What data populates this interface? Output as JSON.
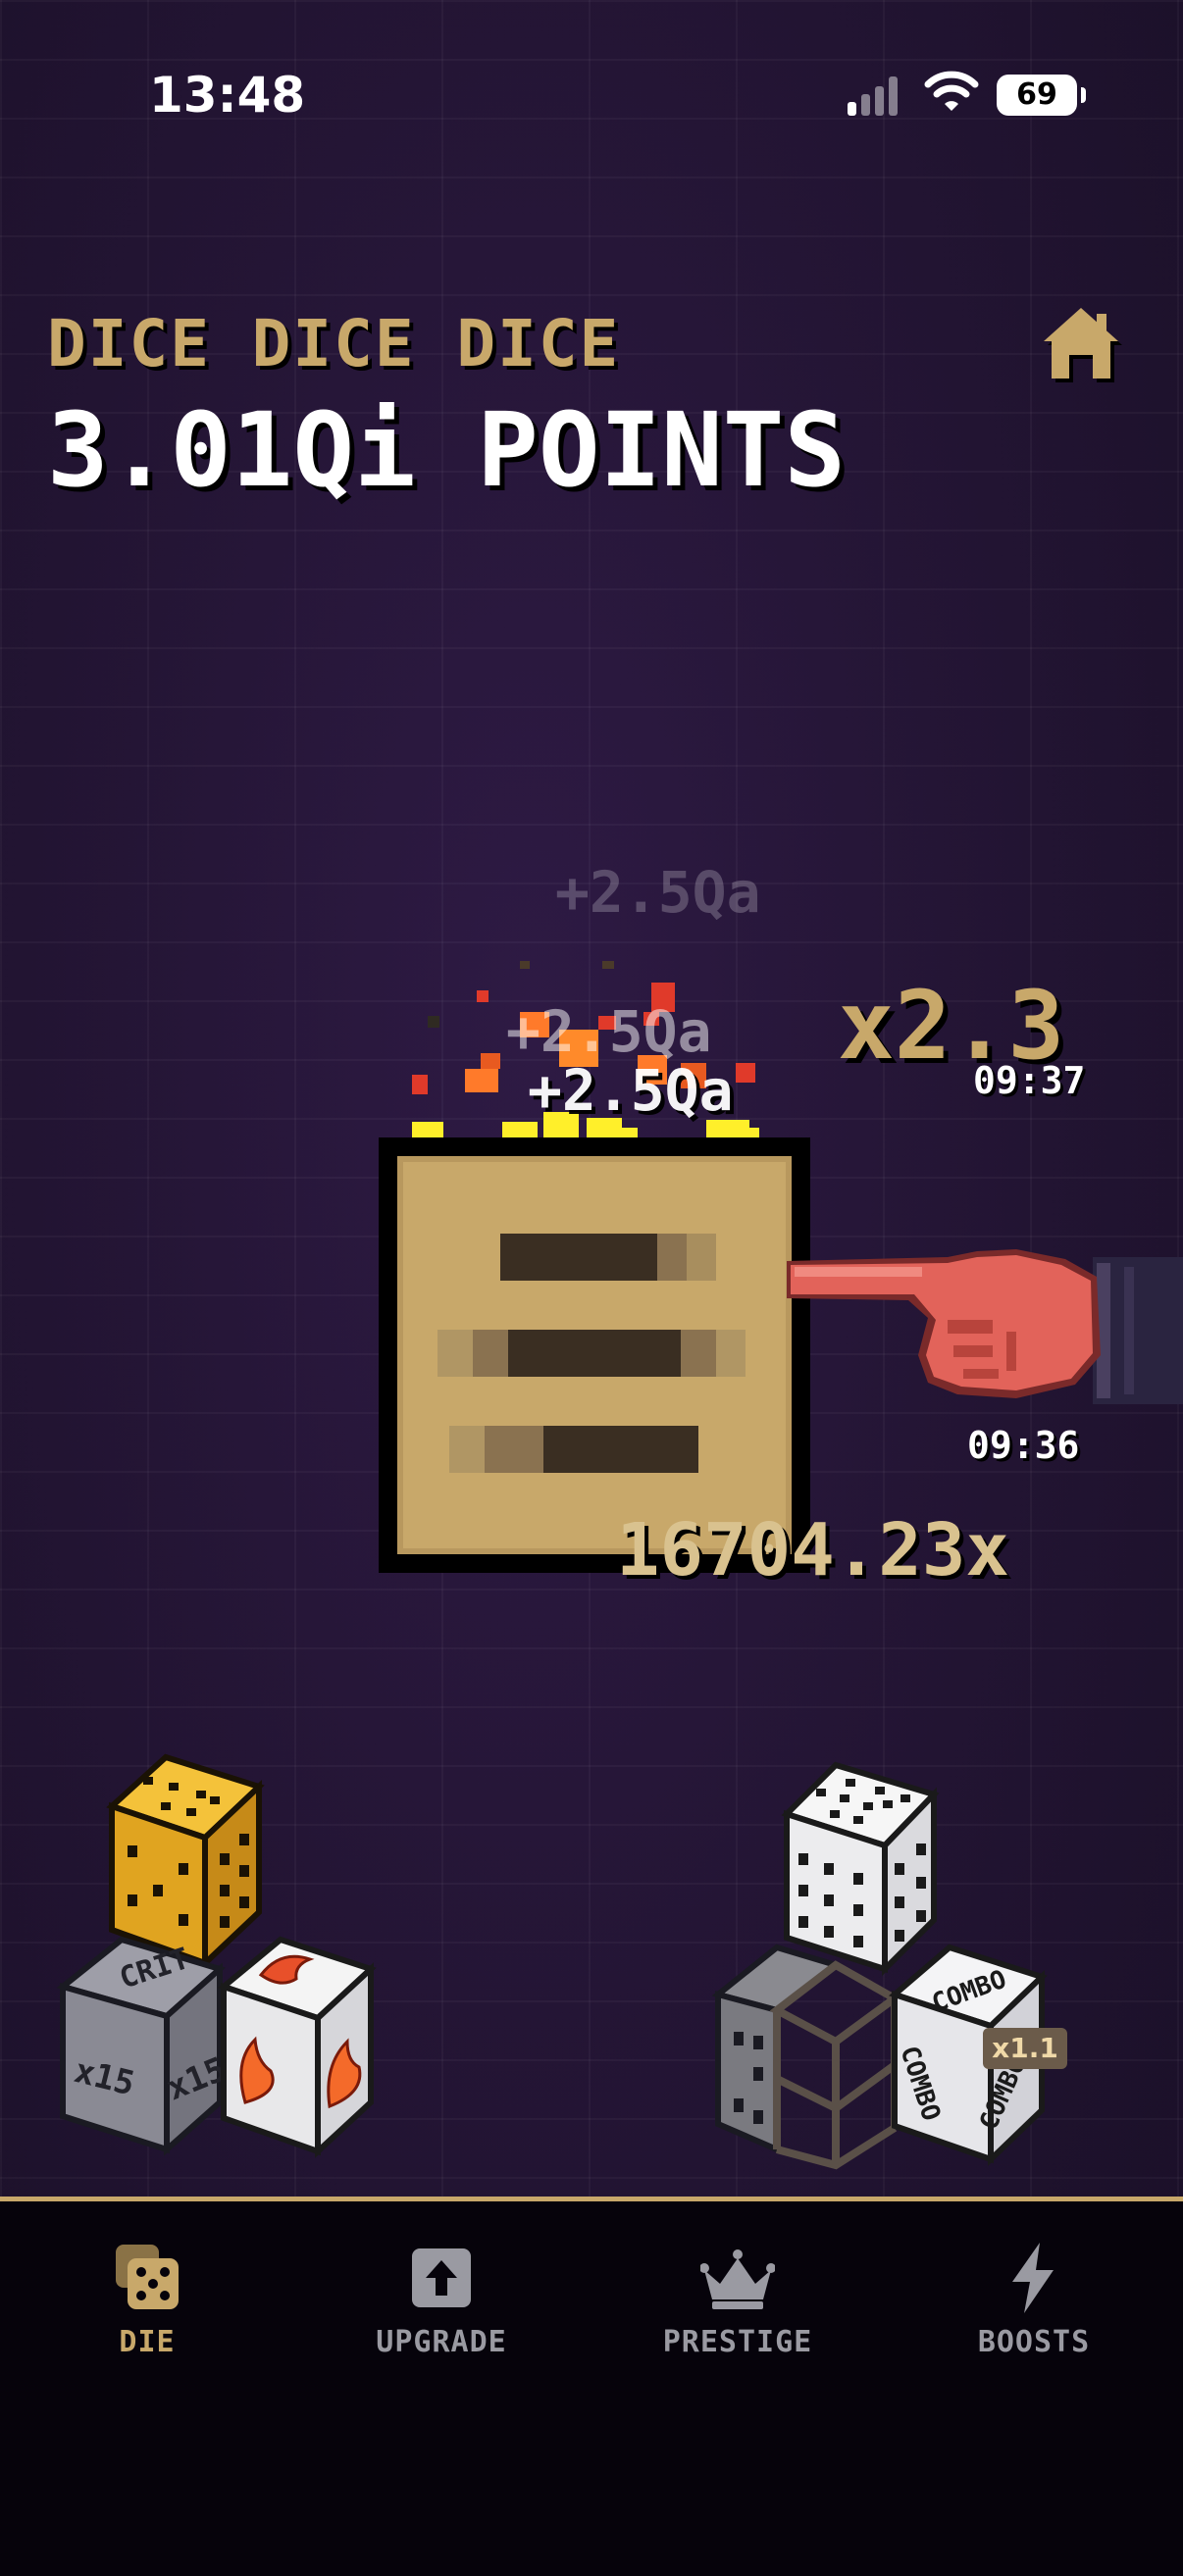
{
  "status_bar": {
    "time": "13:48",
    "battery": "69"
  },
  "header": {
    "game_title": "DICE DICE DICE",
    "points": "3.01Qi POINTS"
  },
  "floating_gains": [
    "+2.5Qa",
    "+2.5Qa",
    "+2.5Qa"
  ],
  "multiplier": {
    "value": "x2.3",
    "timer": "09:37"
  },
  "hand_timer": "09:36",
  "combo_total": "16704.23x",
  "dice": {
    "crit_die": {
      "label": "CRIT",
      "face_text": "x15"
    },
    "combo_die": {
      "label": "COMBO",
      "badge": "x1.1"
    }
  },
  "tabs": [
    {
      "label": "DIE",
      "icon": "dice-icon",
      "active": true
    },
    {
      "label": "UPGRADE",
      "icon": "upgrade-arrow-icon",
      "active": false
    },
    {
      "label": "PRESTIGE",
      "icon": "crown-icon",
      "active": false
    },
    {
      "label": "BOOSTS",
      "icon": "lightning-icon",
      "active": false
    }
  ],
  "colors": {
    "accent": "#c8a86a",
    "background": "#241535",
    "tabbar": "#06030b"
  }
}
